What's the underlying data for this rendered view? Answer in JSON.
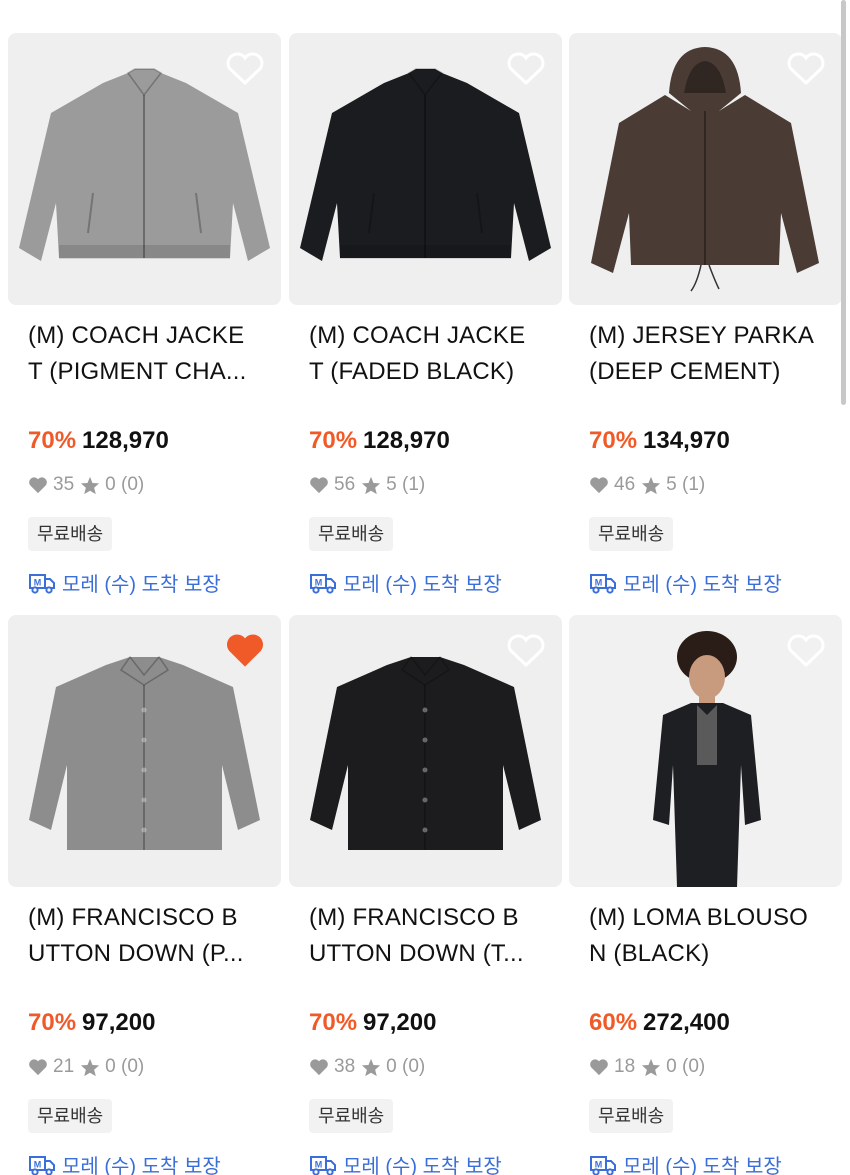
{
  "products": [
    {
      "title_line1": "(M) COACH JACKE",
      "title_line2": "T (PIGMENT CHA...",
      "discount": "70%",
      "price": "128,970",
      "likes": "35",
      "rating": "0 (0)",
      "badge": "무료배송",
      "delivery": "모레 (수) 도착 보장",
      "liked": false,
      "item_color": "#9b9b9b",
      "image_kind": "jacket"
    },
    {
      "title_line1": "(M) COACH JACKE",
      "title_line2": "T (FADED BLACK)",
      "discount": "70%",
      "price": "128,970",
      "likes": "56",
      "rating": "5 (1)",
      "badge": "무료배송",
      "delivery": "모레 (수) 도착 보장",
      "liked": false,
      "item_color": "#1b1c1f",
      "image_kind": "jacket"
    },
    {
      "title_line1": "(M) JERSEY PARKA",
      "title_line2": "(DEEP CEMENT)",
      "discount": "70%",
      "price": "134,970",
      "likes": "46",
      "rating": "5 (1)",
      "badge": "무료배송",
      "delivery": "모레 (수) 도착 보장",
      "liked": false,
      "item_color": "#4a3b35",
      "image_kind": "parka"
    },
    {
      "title_line1": "(M) FRANCISCO B",
      "title_line2": "UTTON DOWN (P...",
      "discount": "70%",
      "price": "97,200",
      "likes": "21",
      "rating": "0 (0)",
      "badge": "무료배송",
      "delivery": "모레 (수) 도착 보장",
      "liked": true,
      "item_color": "#8d8d8d",
      "image_kind": "shirt"
    },
    {
      "title_line1": "(M) FRANCISCO B",
      "title_line2": "UTTON DOWN (T...",
      "discount": "70%",
      "price": "97,200",
      "likes": "38",
      "rating": "0 (0)",
      "badge": "무료배송",
      "delivery": "모레 (수) 도착 보장",
      "liked": false,
      "item_color": "#1c1c1e",
      "image_kind": "shirt"
    },
    {
      "title_line1": "(M) LOMA BLOUSO",
      "title_line2": "N (BLACK)",
      "discount": "60%",
      "price": "272,400",
      "likes": "18",
      "rating": "0 (0)",
      "badge": "무료배송",
      "delivery": "모레 (수) 도착 보장",
      "liked": false,
      "item_color": "#1e1f22",
      "image_kind": "model"
    }
  ],
  "colors": {
    "discount": "#f05a28",
    "liked_heart": "#f05a28",
    "delivery": "#3a6ed8",
    "stat_gray": "#9a9a9a"
  },
  "icons": {
    "like": "heart-icon",
    "rating": "star-icon",
    "delivery": "delivery-truck-icon"
  }
}
